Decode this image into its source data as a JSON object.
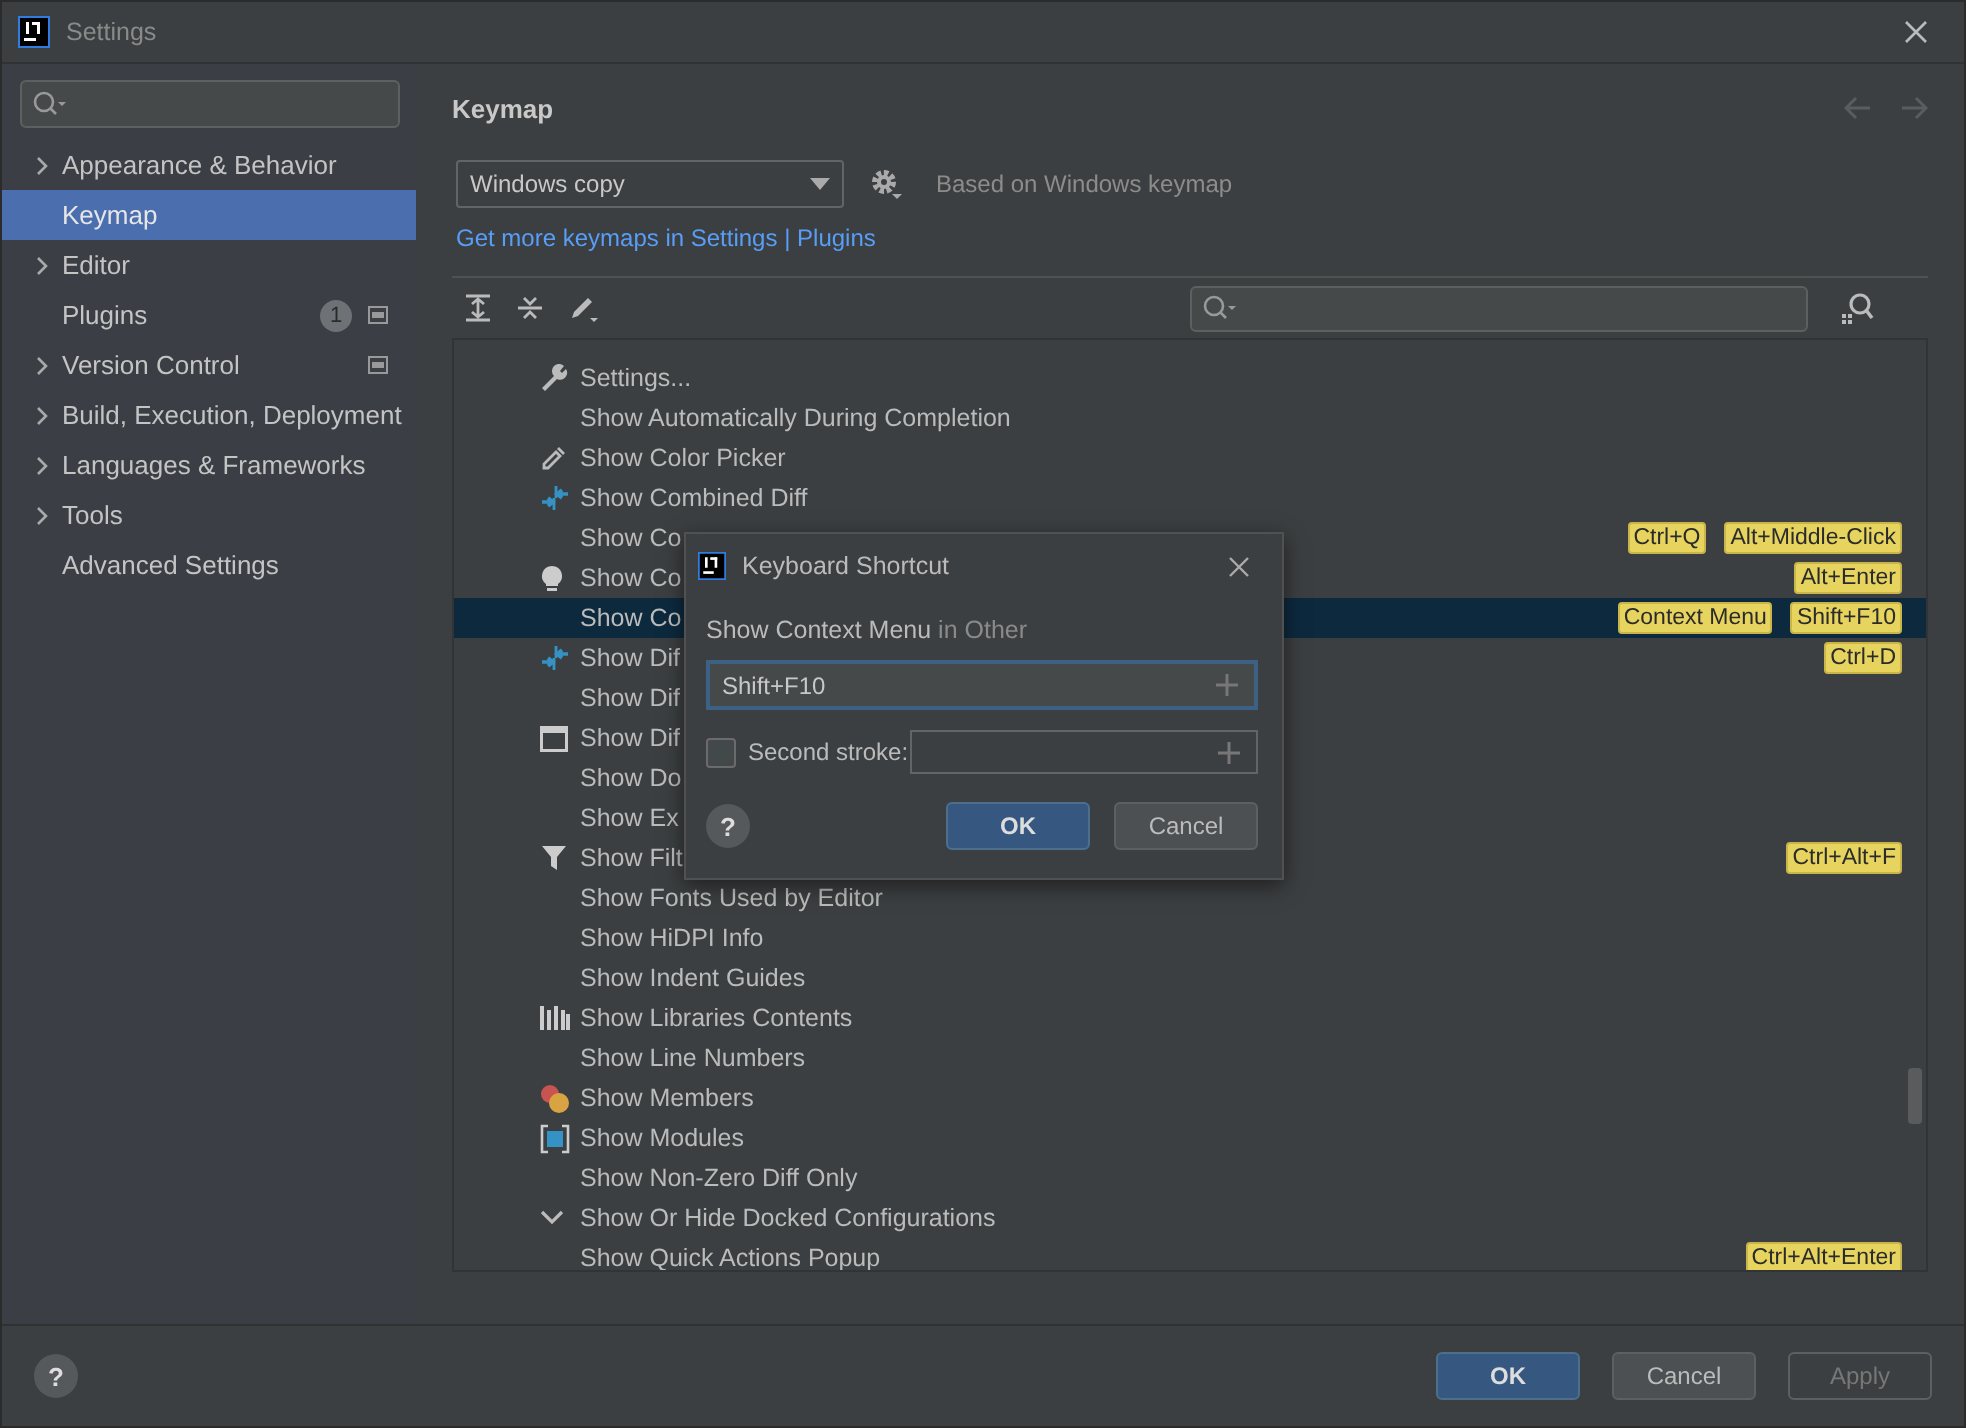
{
  "window": {
    "title": "Settings"
  },
  "sidebar": {
    "items": [
      {
        "label": "Appearance & Behavior",
        "expandable": true,
        "selected": false
      },
      {
        "label": "Keymap",
        "expandable": false,
        "selected": true
      },
      {
        "label": "Editor",
        "expandable": true,
        "selected": false
      },
      {
        "label": "Plugins",
        "expandable": false,
        "selected": false,
        "badge": "1",
        "project_level": true
      },
      {
        "label": "Version Control",
        "expandable": true,
        "selected": false,
        "project_level": true
      },
      {
        "label": "Build, Execution, Deployment",
        "expandable": true,
        "selected": false
      },
      {
        "label": "Languages & Frameworks",
        "expandable": true,
        "selected": false
      },
      {
        "label": "Tools",
        "expandable": true,
        "selected": false
      },
      {
        "label": "Advanced Settings",
        "expandable": false,
        "selected": false
      }
    ]
  },
  "keymap": {
    "title": "Keymap",
    "scheme": "Windows copy",
    "based_on": "Based on Windows keymap",
    "link": "Get more keymaps in Settings | Plugins",
    "rows": [
      {
        "label": "Settings...",
        "kind": "wrench",
        "selected": false,
        "shortcuts": []
      },
      {
        "label": "Show Automatically During Completion",
        "kind": "none",
        "selected": false,
        "shortcuts": []
      },
      {
        "label": "Show Color Picker",
        "kind": "picker",
        "selected": false,
        "shortcuts": []
      },
      {
        "label": "Show Combined Diff",
        "kind": "diff",
        "selected": false,
        "shortcuts": []
      },
      {
        "label": "Show Co",
        "kind": "none",
        "selected": false,
        "shortcuts": [
          "Ctrl+Q",
          "Alt+Middle-Click"
        ]
      },
      {
        "label": "Show Co",
        "kind": "bulb",
        "selected": false,
        "shortcuts": [
          "Alt+Enter"
        ]
      },
      {
        "label": "Show Co",
        "kind": "none",
        "selected": true,
        "shortcuts": [
          "Context Menu",
          "Shift+F10"
        ]
      },
      {
        "label": "Show Dif",
        "kind": "diff",
        "selected": false,
        "shortcuts": [
          "Ctrl+D"
        ]
      },
      {
        "label": "Show Dif",
        "kind": "none",
        "selected": false,
        "shortcuts": []
      },
      {
        "label": "Show Dif",
        "kind": "window",
        "selected": false,
        "shortcuts": []
      },
      {
        "label": "Show Do",
        "kind": "none",
        "selected": false,
        "shortcuts": []
      },
      {
        "label": "Show Ex",
        "kind": "none",
        "selected": false,
        "shortcuts": []
      },
      {
        "label": "Show Filt",
        "kind": "filter",
        "selected": false,
        "shortcuts": [
          "Ctrl+Alt+F"
        ]
      },
      {
        "label": "Show Fonts Used by Editor",
        "kind": "none",
        "selected": false,
        "shortcuts": []
      },
      {
        "label": "Show HiDPI Info",
        "kind": "none",
        "selected": false,
        "shortcuts": []
      },
      {
        "label": "Show Indent Guides",
        "kind": "none",
        "selected": false,
        "shortcuts": []
      },
      {
        "label": "Show Libraries Contents",
        "kind": "library",
        "selected": false,
        "shortcuts": []
      },
      {
        "label": "Show Line Numbers",
        "kind": "none",
        "selected": false,
        "shortcuts": []
      },
      {
        "label": "Show Members",
        "kind": "members",
        "selected": false,
        "shortcuts": []
      },
      {
        "label": "Show Modules",
        "kind": "module",
        "selected": false,
        "shortcuts": []
      },
      {
        "label": "Show Non-Zero Diff Only",
        "kind": "none",
        "selected": false,
        "shortcuts": []
      },
      {
        "label": "Show Or Hide Docked Configurations",
        "kind": "chevron",
        "selected": false,
        "shortcuts": []
      },
      {
        "label": "Show Quick Actions Popup",
        "kind": "none",
        "selected": false,
        "shortcuts": [
          "Ctrl+Alt+Enter"
        ]
      }
    ]
  },
  "dialog": {
    "title": "Keyboard Shortcut",
    "action": "Show Context Menu",
    "context": "in Other",
    "first_stroke": "Shift+F10",
    "second_stroke_label": "Second stroke:",
    "second_stroke_checked": false,
    "help": "?",
    "buttons": [
      "OK",
      "Cancel"
    ]
  },
  "footer": {
    "help": "?",
    "buttons": [
      {
        "label": "OK",
        "kind": "primary"
      },
      {
        "label": "Cancel",
        "kind": "normal"
      },
      {
        "label": "Apply",
        "kind": "disabled"
      }
    ]
  }
}
